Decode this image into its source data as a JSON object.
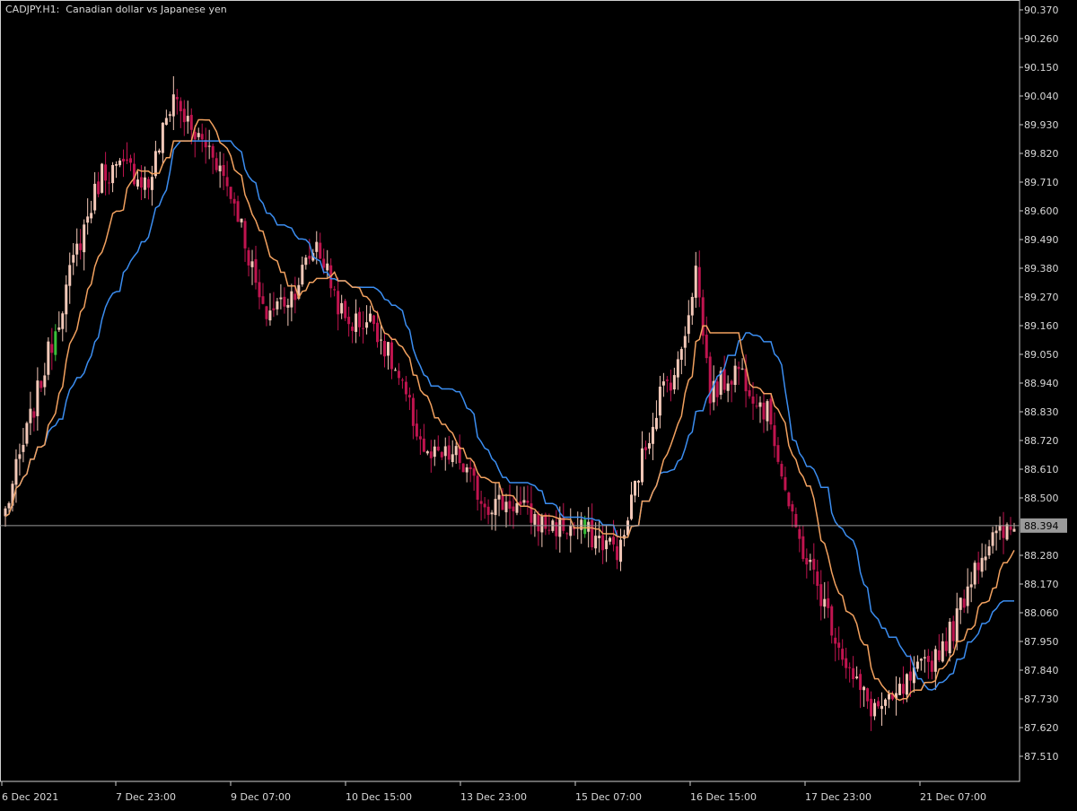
{
  "header": {
    "symbol": "CADJPY.",
    "timeframe": "H1:",
    "description": "Canadian dollar vs Japanese yen"
  },
  "colors": {
    "background": "#000000",
    "frame": "#cfcfcf",
    "text": "#d8d8d8",
    "candle_down": "#c0144f",
    "candle_up": "#f3c8b8",
    "candle_highlight": "#39c039",
    "line_fast": "#3b8df0",
    "line_slow": "#f2a15f",
    "price_line": "#9a9a9a",
    "price_tag_bg": "#9a9a9a"
  },
  "chart_data": {
    "type": "candlestick",
    "y_axis": {
      "ticks": [
        "90.370",
        "90.260",
        "90.150",
        "90.040",
        "89.930",
        "89.820",
        "89.710",
        "89.600",
        "89.490",
        "89.380",
        "89.270",
        "89.160",
        "89.050",
        "88.940",
        "88.830",
        "88.720",
        "88.610",
        "88.500",
        "88.280",
        "88.170",
        "88.060",
        "87.950",
        "87.840",
        "87.730",
        "87.620",
        "87.510"
      ],
      "range": [
        87.45,
        90.4
      ]
    },
    "x_axis": {
      "ticks": [
        "6 Dec 2021",
        "7 Dec 23:00",
        "9 Dec 07:00",
        "10 Dec 15:00",
        "13 Dec 23:00",
        "15 Dec 07:00",
        "16 Dec 15:00",
        "17 Dec 23:00",
        "21 Dec 07:00"
      ]
    },
    "current_price": "88.394",
    "close_keypoints": [
      [
        0,
        88.45
      ],
      [
        10,
        88.95
      ],
      [
        20,
        89.45
      ],
      [
        27,
        89.75
      ],
      [
        35,
        89.76
      ],
      [
        40,
        89.7
      ],
      [
        47,
        90.05
      ],
      [
        52,
        89.9
      ],
      [
        58,
        89.83
      ],
      [
        65,
        89.6
      ],
      [
        72,
        89.2
      ],
      [
        80,
        89.28
      ],
      [
        87,
        89.48
      ],
      [
        95,
        89.17
      ],
      [
        103,
        89.18
      ],
      [
        110,
        88.95
      ],
      [
        118,
        88.65
      ],
      [
        126,
        88.66
      ],
      [
        134,
        88.48
      ],
      [
        142,
        88.48
      ],
      [
        150,
        88.4
      ],
      [
        160,
        88.38
      ],
      [
        172,
        88.3
      ],
      [
        177,
        88.6
      ],
      [
        183,
        88.9
      ],
      [
        188,
        89.0
      ],
      [
        193,
        89.38
      ],
      [
        197,
        88.9
      ],
      [
        205,
        89.0
      ],
      [
        214,
        88.8
      ],
      [
        220,
        88.4
      ],
      [
        226,
        88.2
      ],
      [
        232,
        87.98
      ],
      [
        237,
        87.8
      ],
      [
        242,
        87.7
      ],
      [
        247,
        87.7
      ],
      [
        253,
        87.8
      ],
      [
        259,
        87.88
      ],
      [
        265,
        88.0
      ],
      [
        271,
        88.25
      ],
      [
        276,
        88.34
      ],
      [
        282,
        88.38
      ]
    ],
    "series": [
      {
        "name": "",
        "color": "#3b8df0",
        "lookback": 24
      },
      {
        "name": "",
        "color": "#f2a15f",
        "lookback": 12
      }
    ]
  }
}
